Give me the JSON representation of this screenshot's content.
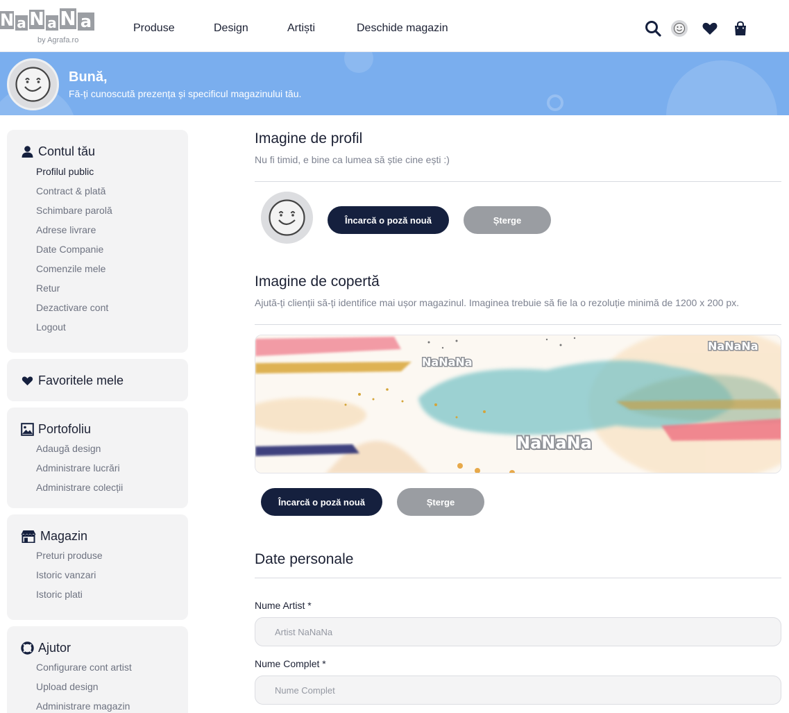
{
  "header": {
    "logo_letters": [
      "N",
      "a",
      "N",
      "a",
      "N",
      "a"
    ],
    "logo_sub": "by Agrafa.ro",
    "nav": [
      "Produse",
      "Design",
      "Artiști",
      "Deschide magazin"
    ],
    "icons": [
      "search-icon",
      "avatar",
      "heart-icon",
      "shopping-bag-icon"
    ]
  },
  "banner": {
    "greeting": "Bună,",
    "subtitle": "Fă-ți cunoscută prezența și specificul magazinului tău."
  },
  "sidebar": {
    "account": {
      "title": "Contul tău",
      "icon": "user-icon",
      "items": [
        "Profilul public",
        "Contract & plată",
        "Schimbare parolă",
        "Adrese livrare",
        "Date Companie",
        "Comenzile mele",
        "Retur",
        "Dezactivare cont",
        "Logout"
      ]
    },
    "favorites": {
      "title": "Favoritele mele",
      "icon": "heart-icon"
    },
    "portfolio": {
      "title": "Portofoliu",
      "icon": "image-icon",
      "items": [
        "Adaugă design",
        "Administrare lucrări",
        "Administrare colecții"
      ]
    },
    "shop": {
      "title": "Magazin",
      "icon": "store-icon",
      "items": [
        "Preturi produse",
        "Istoric vanzari",
        "Istoric plati"
      ]
    },
    "help": {
      "title": "Ajutor",
      "icon": "lifebuoy-icon",
      "items": [
        "Configurare cont artist",
        "Upload design",
        "Administrare magazin"
      ]
    }
  },
  "profile_image": {
    "title": "Imagine de profil",
    "subtitle": "Nu fi timid, e bine ca lumea să știe cine ești :)",
    "upload_label": "Încarcă o poză nouă",
    "delete_label": "Șterge"
  },
  "cover_image": {
    "title": "Imagine de copertă",
    "subtitle": "Ajută-ți clienții să-ți identifice mai ușor magazinul. Imaginea trebuie să fie la o rezoluție minimă de 1200 x 200 px.",
    "watermark": "NaNaNa",
    "upload_label": "Încarcă o poză nouă",
    "delete_label": "Șterge"
  },
  "personal": {
    "title": "Date personale",
    "artist_label": "Nume Artist *",
    "artist_placeholder": "Artist NaNaNa",
    "full_label": "Nume Complet *",
    "full_placeholder": "Nume Complet"
  },
  "colors": {
    "navy": "#15203e",
    "banner_blue": "#7aaeee",
    "card_bg": "#f3f3f4",
    "button_grey": "#9a9da2"
  }
}
